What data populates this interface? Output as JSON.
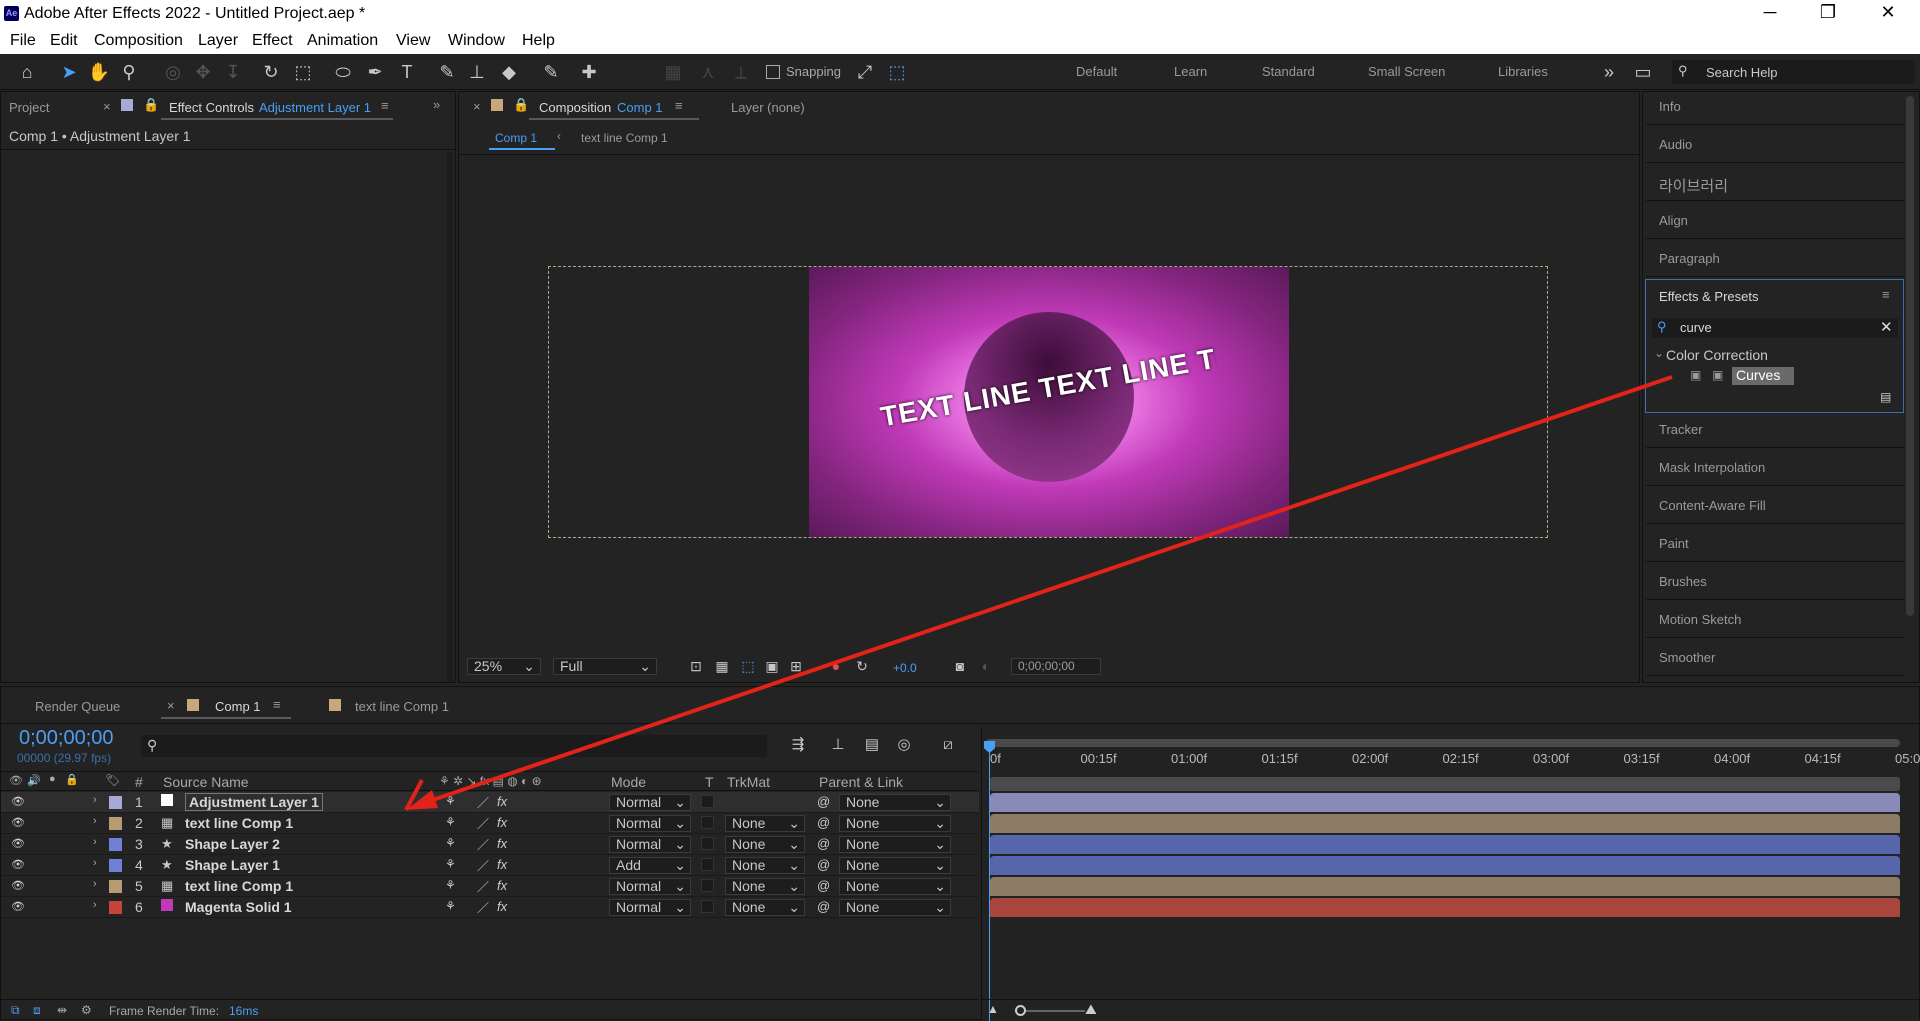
{
  "app": {
    "title": "Adobe After Effects 2022 - Untitled Project.aep *",
    "icon": "Ae"
  },
  "menu": [
    "File",
    "Edit",
    "Composition",
    "Layer",
    "Effect",
    "Animation",
    "View",
    "Window",
    "Help"
  ],
  "toolbar": {
    "snapping": "Snapping",
    "workspaces": [
      "Default",
      "Learn",
      "Standard",
      "Small Screen",
      "Libraries"
    ],
    "search_help": "Search Help"
  },
  "left_panel": {
    "tab_project": "Project",
    "tab_effect_controls": "Effect Controls",
    "effect_layer": "Adjustment Layer 1",
    "breadcrumb": "Comp 1 • Adjustment Layer 1"
  },
  "comp_panel": {
    "tab_composition": "Composition",
    "comp_name": "Comp 1",
    "layer_tab": "Layer (none)",
    "subtabs": [
      "Comp 1",
      "text line Comp 1"
    ],
    "zoom": "25%",
    "resolution": "Full",
    "exposure": "+0.0",
    "timecode": "0;00;00;00",
    "preview_text": "TEXT LINE TEXT LINE TEXT LINE TEXT"
  },
  "right_panel": {
    "items_top": [
      "Info",
      "Audio",
      "라이브러리",
      "Align",
      "Paragraph"
    ],
    "effects_presets": {
      "title": "Effects & Presets",
      "search": "curve",
      "category": "Color Correction",
      "effect": "Curves"
    },
    "items_bottom": [
      "Tracker",
      "Mask Interpolation",
      "Content-Aware Fill",
      "Paint",
      "Brushes",
      "Motion Sketch",
      "Smoother"
    ]
  },
  "timeline": {
    "tabs": [
      "Render Queue",
      "Comp 1",
      "text line Comp 1"
    ],
    "timecode": "0;00;00;00",
    "fps": "00000 (29.97 fps)",
    "columns": {
      "num": "#",
      "source": "Source Name",
      "mode": "Mode",
      "t": "T",
      "trkmat": "TrkMat",
      "parent": "Parent & Link"
    },
    "ruler": [
      "0f",
      "00:15f",
      "01:00f",
      "01:15f",
      "02:00f",
      "02:15f",
      "03:00f",
      "03:15f",
      "04:00f",
      "04:15f",
      "05:0"
    ],
    "layers": [
      {
        "num": "1",
        "name": "Adjustment Layer 1",
        "mode": "Normal",
        "trkmat": "",
        "parent": "None",
        "label": "#a9a9d8",
        "bar": "#8a8ab8",
        "icon": "adj"
      },
      {
        "num": "2",
        "name": "text line Comp 1",
        "mode": "Normal",
        "trkmat": "None",
        "parent": "None",
        "label": "#b89b72",
        "bar": "#8c7c65",
        "icon": "comp"
      },
      {
        "num": "3",
        "name": "Shape Layer 2",
        "mode": "Normal",
        "trkmat": "None",
        "parent": "None",
        "label": "#6f80d6",
        "bar": "#5666aa",
        "icon": "star"
      },
      {
        "num": "4",
        "name": "Shape Layer 1",
        "mode": "Add",
        "trkmat": "None",
        "parent": "None",
        "label": "#6f80d6",
        "bar": "#5666aa",
        "icon": "star"
      },
      {
        "num": "5",
        "name": "text line Comp 1",
        "mode": "Normal",
        "trkmat": "None",
        "parent": "None",
        "label": "#b89b72",
        "bar": "#8c7c65",
        "icon": "comp"
      },
      {
        "num": "6",
        "name": "Magenta Solid 1",
        "mode": "Normal",
        "trkmat": "None",
        "parent": "None",
        "label": "#c8443a",
        "bar": "#a8463e",
        "icon": "solid"
      }
    ],
    "footer": {
      "label": "Frame Render Time:",
      "value": "16ms"
    }
  },
  "colors": {
    "accent": "#4a9ff5",
    "arrow": "#e2231a",
    "magenta": "#c03ab8"
  }
}
